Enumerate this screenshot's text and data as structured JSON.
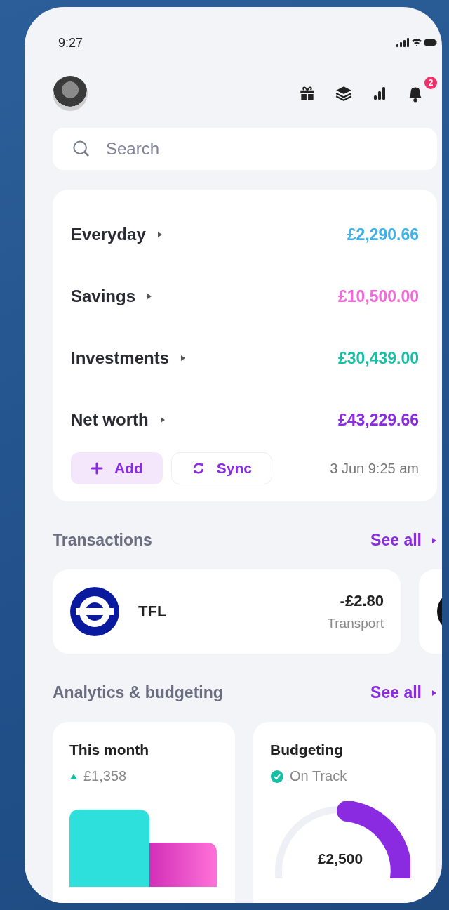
{
  "status_bar": {
    "time": "9:27"
  },
  "header": {
    "notification_count": "2"
  },
  "search": {
    "placeholder": "Search"
  },
  "accounts": [
    {
      "name": "Everyday",
      "amount": "£2,290.66",
      "color": "#3fb0e8"
    },
    {
      "name": "Savings",
      "amount": "£10,500.00",
      "color": "#f06ad8"
    },
    {
      "name": "Investments",
      "amount": "£30,439.00",
      "color": "#18bfa5"
    },
    {
      "name": "Net worth",
      "amount": "£43,229.66",
      "color": "#8a2be2"
    }
  ],
  "account_actions": {
    "add_label": "Add",
    "sync_label": "Sync",
    "last_synced": "3 Jun 9:25 am"
  },
  "transactions": {
    "title": "Transactions",
    "see_all": "See all",
    "items": [
      {
        "merchant": "TFL",
        "amount": "-£2.80",
        "category": "Transport"
      }
    ]
  },
  "analytics": {
    "title": "Analytics & budgeting",
    "see_all": "See all",
    "this_month": {
      "title": "This month",
      "change": "£1,358"
    },
    "budgeting": {
      "title": "Budgeting",
      "status": "On Track",
      "amount": "£2,500"
    }
  }
}
